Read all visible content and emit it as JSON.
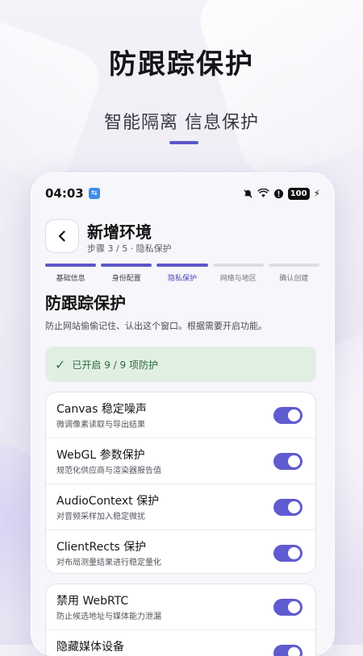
{
  "hero": {
    "title": "防跟踪保护",
    "subtitle": "智能隔离  信息保护"
  },
  "status_bar": {
    "time": "04:03",
    "battery": "100",
    "icons": [
      "usb-icon",
      "mute-icon",
      "wifi-icon",
      "alarm-icon",
      "battery-icon",
      "charging-icon"
    ]
  },
  "header": {
    "title": "新增环境",
    "step_text": "步骤 3 / 5 · 隐私保护"
  },
  "steps": [
    {
      "label": "基础信息",
      "state": "done"
    },
    {
      "label": "身份配置",
      "state": "done"
    },
    {
      "label": "隐私保护",
      "state": "active"
    },
    {
      "label": "网络与地区",
      "state": "todo"
    },
    {
      "label": "确认创建",
      "state": "todo"
    }
  ],
  "section": {
    "title": "防跟踪保护",
    "description": "防止网站偷偷记住、认出这个窗口。根据需要开启功能。",
    "enabled_text": "已开启 9 / 9 项防护"
  },
  "protections": [
    {
      "name": "Canvas 稳定噪声",
      "desc": "微调像素读取与导出结果",
      "on": true
    },
    {
      "name": "WebGL 参数保护",
      "desc": "规范化供应商与渲染器报告值",
      "on": true
    },
    {
      "name": "AudioContext 保护",
      "desc": "对音频采样加入稳定微扰",
      "on": true
    },
    {
      "name": "ClientRects 保护",
      "desc": "对布局测量结果进行稳定量化",
      "on": true
    }
  ],
  "protections2": [
    {
      "name": "禁用 WebRTC",
      "desc": "防止候选地址与媒体能力泄漏",
      "on": true
    },
    {
      "name": "隐藏媒体设备",
      "desc": "",
      "on": true
    }
  ],
  "colors": {
    "accent": "#5b57c9",
    "toggle_on": "#5f5bd0",
    "success_bg": "#e1efe3",
    "success_text": "#2f6a3d"
  }
}
